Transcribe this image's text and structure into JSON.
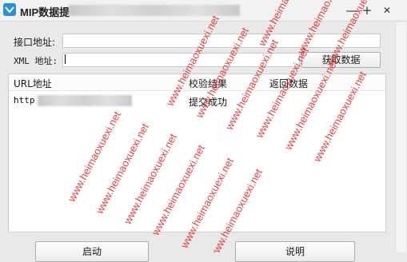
{
  "window": {
    "title": "MIP数据提",
    "minimize_glyph": "—",
    "maximize_glyph": "+",
    "close_glyph": "✕",
    "minimize_label": "minimize",
    "maximize_label": "maximize",
    "close_label": "close"
  },
  "form": {
    "api_label": "接口地址:",
    "api_value": "",
    "xml_label": "XML 地址:",
    "xml_value": "",
    "fetch_button": "获取数据"
  },
  "results": {
    "columns": [
      "URL地址",
      "校验结果",
      "返回数据"
    ],
    "rows": [
      {
        "url": "http",
        "status": "提交成功",
        "data": ""
      }
    ]
  },
  "footer": {
    "start_button": "启动",
    "help_button": "说明"
  },
  "watermark": {
    "text": "www.heimaoxuexi.net",
    "color": "#e6201f"
  },
  "icons": {
    "app": "app-logo-icon"
  }
}
